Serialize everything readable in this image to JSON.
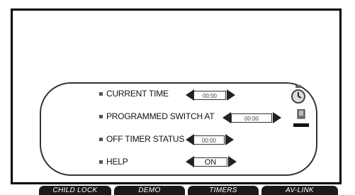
{
  "menu": {
    "rows": [
      {
        "label": "CURRENT TIME",
        "value": "00:00"
      },
      {
        "label": "PROGRAMMED SWITCH AT",
        "value": "00:00"
      },
      {
        "label": "OFF TIMER STATUS",
        "value": "00:00"
      },
      {
        "label": "HELP",
        "value": "ON"
      }
    ]
  },
  "tabs": [
    "CHILD LOCK",
    "DEMO",
    "TIMERS",
    "AV-LINK"
  ],
  "icons": {
    "clock": "clock-icon",
    "tv": "tv-icon"
  }
}
